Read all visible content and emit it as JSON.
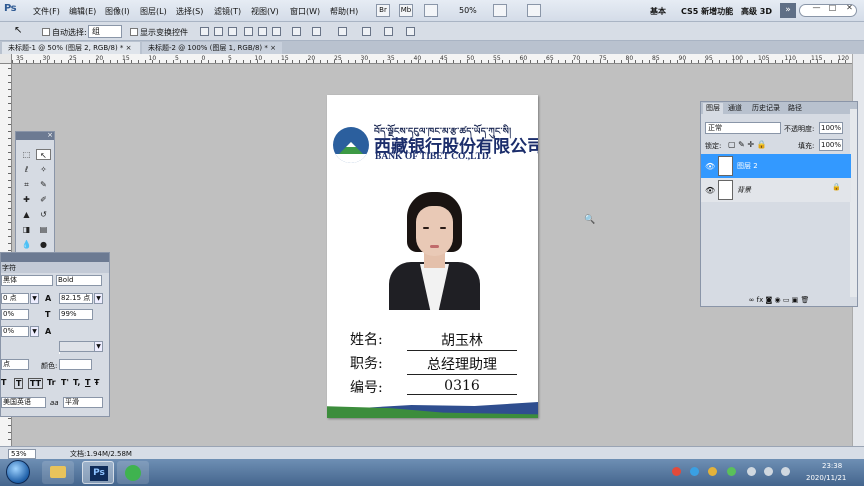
{
  "menubar": {
    "logo": "Ps",
    "items": [
      "文件(F)",
      "编辑(E)",
      "图像(I)",
      "图层(L)",
      "选择(S)",
      "滤镜(T)",
      "视图(V)",
      "窗口(W)",
      "帮助(H)"
    ],
    "icon_br": "Br",
    "icon_mb": "Mb",
    "zoom": "50%",
    "workspaces": [
      "基本",
      "CS5 新增功能",
      "高级 3D"
    ],
    "more": "»",
    "win_min": "—",
    "win_max": "□",
    "win_close": "✕"
  },
  "options": {
    "auto_select_label": "自动选择:",
    "auto_select_value": "组",
    "show_transform_label": "显示变换控件"
  },
  "tabs": [
    {
      "label": "未标题-1 @ 50% (图层 2, RGB/8) * ×"
    },
    {
      "label": "未标题-2 @ 100% (图层 1, RGB/8) * ×"
    }
  ],
  "ruler": {
    "h_numbers": [
      "35",
      "30",
      "25",
      "20",
      "15",
      "10",
      "5",
      "0",
      "5",
      "10",
      "15",
      "20",
      "25",
      "30",
      "35",
      "40",
      "45",
      "50",
      "55",
      "60",
      "65",
      "70",
      "75",
      "80",
      "85",
      "90",
      "95",
      "100",
      "105",
      "110",
      "115",
      "120"
    ]
  },
  "card": {
    "tibetan": "བོད་ལྗོངས་དངུལ་ཁང་མ་རྩ་ཚད་ཡོད་ཀུང་སི།",
    "bank_name_cn": "西藏银行股份有限公司",
    "bank_name_en": "BANK OF TIBET CO.,LTD.",
    "fields": [
      {
        "label": "姓名:",
        "value": "胡玉林"
      },
      {
        "label": "职务:",
        "value": "总经理助理"
      },
      {
        "label": "编号:",
        "value": "0316"
      }
    ],
    "colors": {
      "brand_blue": "#1b2d6b",
      "brand_green": "#3c8d3c",
      "logo_blue": "#2b5f9e"
    }
  },
  "tools_panel": {
    "close": "×",
    "tools": [
      "marquee-icon",
      "move-icon",
      "lasso-icon",
      "magic-wand-icon",
      "crop-icon",
      "eyedropper-icon",
      "healing-icon",
      "brush-icon",
      "stamp-icon",
      "history-brush-icon",
      "eraser-icon",
      "gradient-icon",
      "blur-icon",
      "dodge-icon"
    ]
  },
  "char_panel": {
    "tab": "字符",
    "font_family": "黑体",
    "font_style": "Bold",
    "font_size": "0 点",
    "leading": "82.15 点",
    "tracking_value": "0%",
    "vertical_scale": "99%",
    "horizontal_scale": "0%",
    "baseline": "点",
    "color_label": "颜色:",
    "style_buttons": [
      "T",
      "T",
      "TT",
      "Tr",
      "T'",
      "T,",
      "T",
      "Ŧ"
    ],
    "language": "美国英语",
    "aa_icon": "aa",
    "antialias": "平滑"
  },
  "layers_panel": {
    "tabs": [
      "图层",
      "通道",
      "历史记录",
      "路径"
    ],
    "blend_mode": "正常",
    "opacity_label": "不透明度:",
    "opacity": "100%",
    "lock_label": "锁定:",
    "fill_label": "填充:",
    "fill": "100%",
    "layers": [
      {
        "name": "图层 2",
        "selected": true
      },
      {
        "name": "背景",
        "selected": false
      }
    ],
    "bottom_icons": "∞ fx ◙ ◉ ▭ ▣ 🗑",
    "lock_glyph": "🔒"
  },
  "status": {
    "zoom": "53%",
    "doc": "文档:1.94M/2.58M"
  },
  "taskbar": {
    "time": "23:38",
    "date": "2020/11/21",
    "ps_label": "Ps"
  }
}
